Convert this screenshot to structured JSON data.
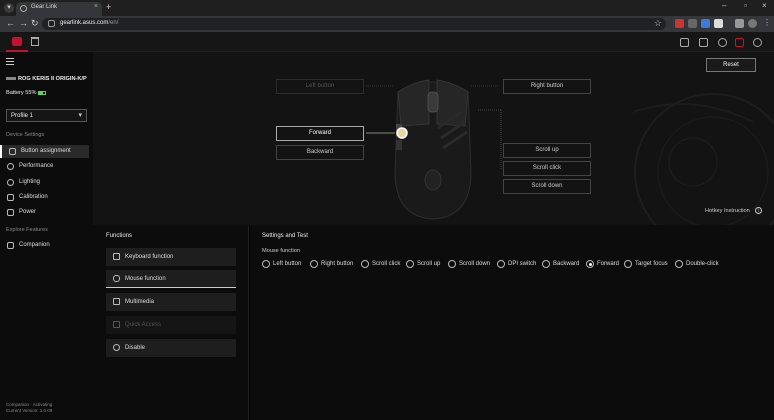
{
  "browser": {
    "tab_title": "Gear Link",
    "url_host": "gearlink.asus.com",
    "url_path": "/en/"
  },
  "sidebar": {
    "device_name": "ROG KERIS II ORIGIN-K/P",
    "battery": "Battery 55%",
    "profile": "Profile 1",
    "device_settings_header": "Device Settings",
    "items": [
      {
        "label": "Button assignment"
      },
      {
        "label": "Performance"
      },
      {
        "label": "Lighting"
      },
      {
        "label": "Calibration"
      },
      {
        "label": "Power"
      }
    ],
    "explore_header": "Explore Features",
    "explore_items": [
      {
        "label": "Companion"
      }
    ],
    "footer_line1": "Companion · Activating",
    "footer_line2": "Current Version: 1.0.09"
  },
  "mouse_panel": {
    "reset": "Reset",
    "left_buttons": {
      "left": "Left button",
      "forward": "Forward",
      "backward": "Backward"
    },
    "right_buttons": {
      "right": "Right button",
      "scroll_up": "Scroll up",
      "scroll_click": "Scroll click",
      "scroll_down": "Scroll down"
    },
    "hotkey": "Hotkey Instruction"
  },
  "functions": {
    "title": "Functions",
    "items": [
      {
        "label": "Keyboard function"
      },
      {
        "label": "Mouse function"
      },
      {
        "label": "Multimedia"
      },
      {
        "label": "Quick Access"
      },
      {
        "label": "Disable"
      }
    ]
  },
  "settings": {
    "title": "Settings and Test",
    "group_label": "Mouse function",
    "options": [
      "Left button",
      "Right button",
      "Scroll click",
      "Scroll up",
      "Scroll down",
      "DPI switch",
      "Backward",
      "Forward",
      "Target focus",
      "Double-click"
    ],
    "selected": "Forward"
  },
  "colors": {
    "accent": "#c8102e",
    "battery": "#5fd35f"
  }
}
